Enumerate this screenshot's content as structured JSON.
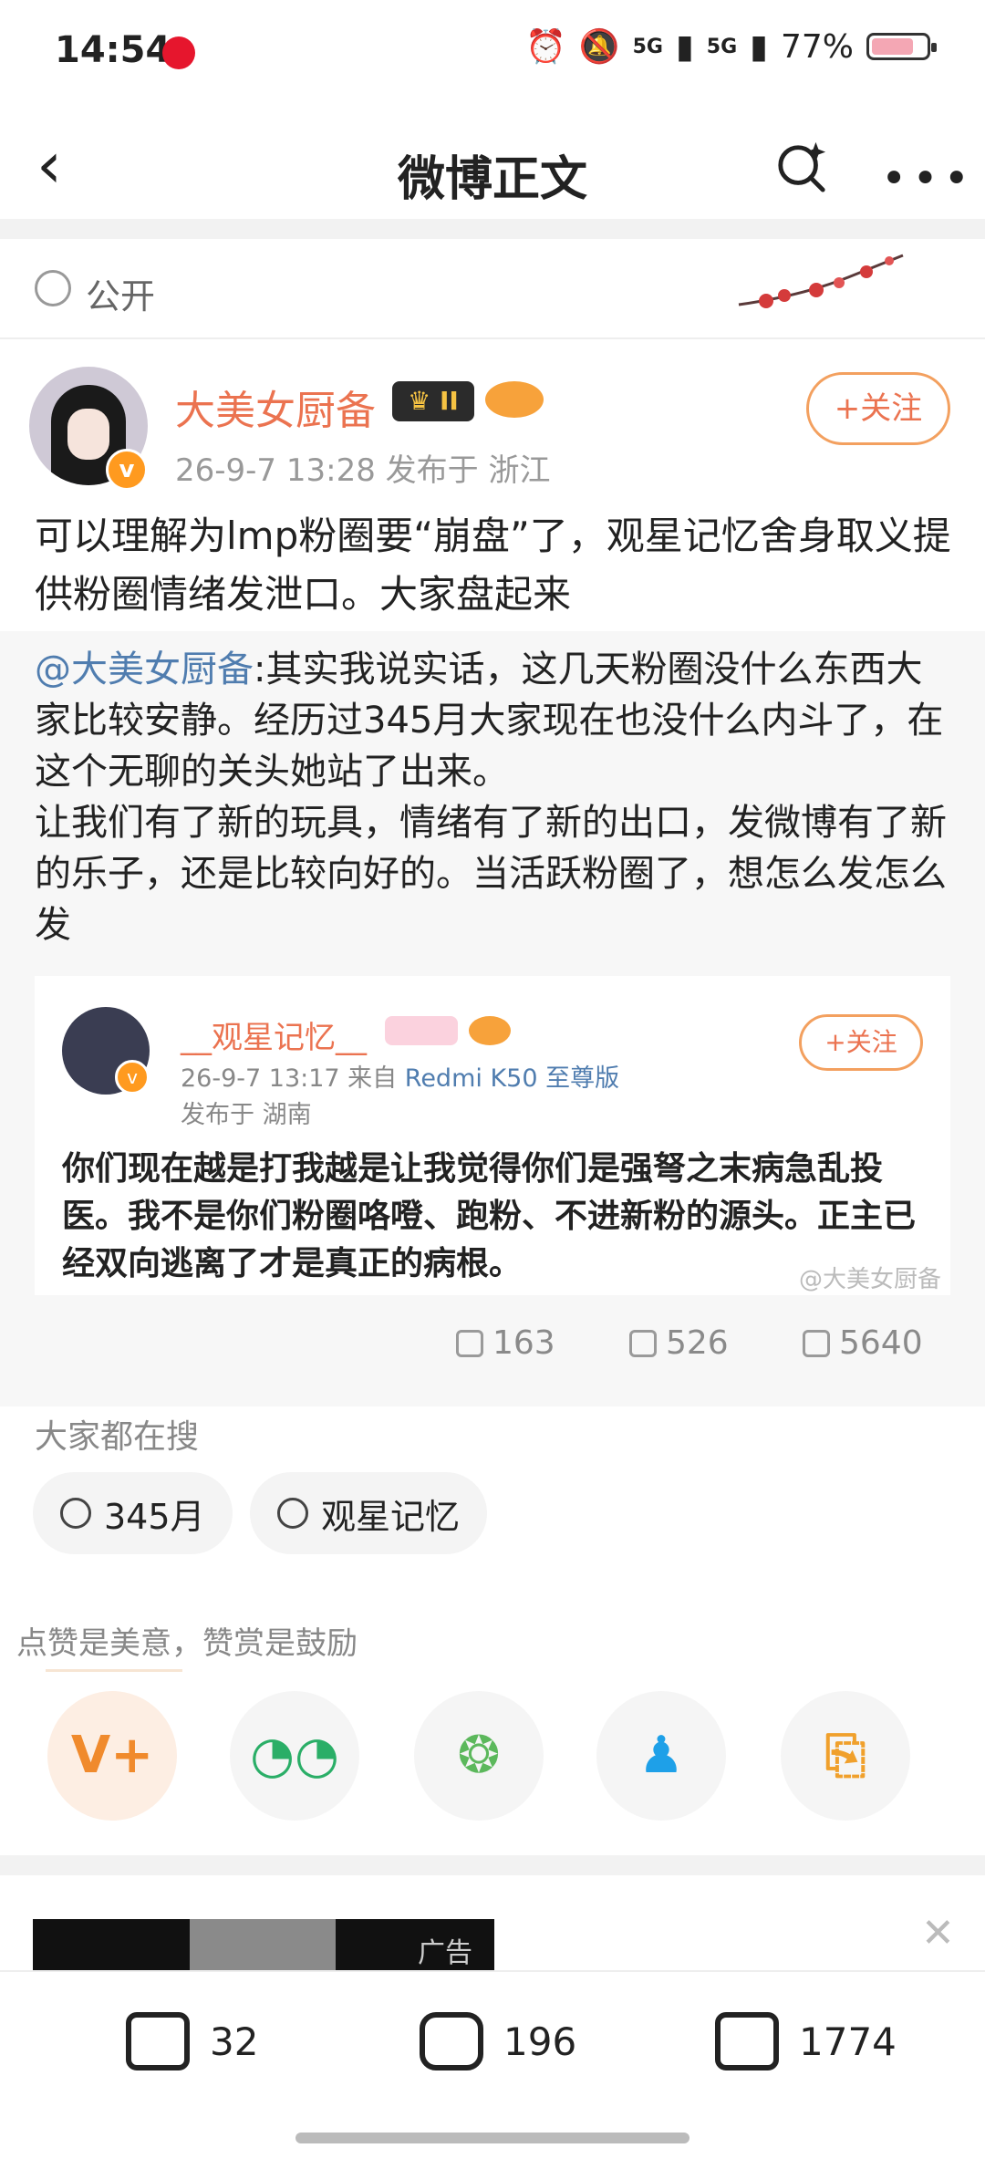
{
  "status": {
    "time": "14:54",
    "network1": "5G",
    "network2": "5G",
    "battery": "77%",
    "battery_level": 0.77
  },
  "nav": {
    "title": "微博正文",
    "back_icon": "chevron-left-icon",
    "search_icon": "search-sparkle-icon",
    "more_icon": "more-dots-icon"
  },
  "visibility": {
    "label": "公开"
  },
  "post": {
    "author": "大美女厨备",
    "vip_label": "II",
    "meta": "26-9-7 13:28   发布于 浙江",
    "follow_label": "+关注",
    "text": "可以理解为lmp粉圈要“崩盘”了，观星记忆舍身取义提供粉圈情绪发泄口。大家盘起来"
  },
  "repost": {
    "mention": "@大美女厨备",
    "text": ":其实我说实话，这几天粉圈没什么东西大家比较安静。经历过345月大家现在也没什么内斗了，在这个无聊的关头她站了出来。\n让我们有了新的玩具，情绪有了新的出口，发微博有了新的乐子，还是比较向好的。当活跃粉圈了，想怎么发怎么发",
    "card": {
      "name": "__观星记忆__",
      "date": "26-9-7 13:17  来自 ",
      "device": "Redmi K50 至尊版",
      "location": "发布于 湖南",
      "follow_label": "+关注",
      "text": "你们现在越是打我越是让我觉得你们是强弩之末病急乱投医。我不是你们粉圈咯噔、跑粉、不进新粉的源头。正主已经双向逃离了才是真正的病根。",
      "watermark": "@大美女厨备"
    },
    "stats": {
      "reposts": "163",
      "comments": "526",
      "likes": "5640"
    }
  },
  "hot": {
    "title": "大家都在搜",
    "chips": [
      "345月",
      "观星记忆"
    ]
  },
  "reward": {
    "tip": "点赞是美意，赞赏是鼓励",
    "buttons": [
      {
        "name": "weibo-v-plus-icon",
        "glyph": "V+",
        "color": "#f08a2c"
      },
      {
        "name": "wechat-icon",
        "glyph": "◔◔",
        "color": "#2aae67"
      },
      {
        "name": "moments-icon",
        "glyph": "❂",
        "color": "#5cb85c"
      },
      {
        "name": "qq-icon",
        "glyph": "♟",
        "color": "#1ea0e8"
      },
      {
        "name": "save-image-icon",
        "glyph": "⎘",
        "color": "#f0a02c"
      }
    ]
  },
  "ad": {
    "label": "广告",
    "close": "✕"
  },
  "bottom": {
    "reposts": "32",
    "comments": "196",
    "likes": "1774"
  }
}
